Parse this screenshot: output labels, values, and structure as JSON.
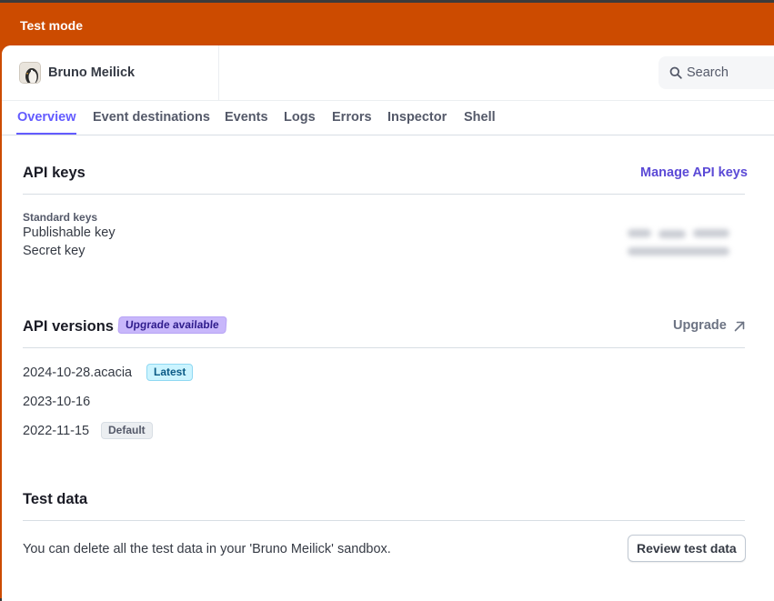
{
  "banner": {
    "label": "Test mode"
  },
  "account": {
    "name": "Bruno Meilick",
    "avatar_icon": "penguin-avatar-icon"
  },
  "search": {
    "label": "Search",
    "icon": "search-icon"
  },
  "tabs": [
    {
      "label": "Overview",
      "active": true
    },
    {
      "label": "Event destinations"
    },
    {
      "label": "Events"
    },
    {
      "label": "Logs"
    },
    {
      "label": "Errors"
    },
    {
      "label": "Inspector"
    },
    {
      "label": "Shell"
    }
  ],
  "api_keys": {
    "title": "API keys",
    "manage_link": "Manage API keys",
    "standard_keys_label": "Standard keys",
    "publishable_label": "Publishable key",
    "secret_label": "Secret key"
  },
  "api_versions": {
    "title": "API versions",
    "upgrade_badge": "Upgrade available",
    "upgrade_link": "Upgrade",
    "upgrade_icon": "external-arrow-icon",
    "versions": [
      {
        "name": "2024-10-28.acacia",
        "badge": "Latest"
      },
      {
        "name": "2023-10-16",
        "badge": ""
      },
      {
        "name": "2022-11-15",
        "badge": "Default"
      }
    ]
  },
  "test_data": {
    "title": "Test data",
    "description": "You can delete all the test data in your 'Bruno Meilick' sandbox.",
    "review_button": "Review test data"
  },
  "colors": {
    "banner": "#cc4b00",
    "accent": "#635bff",
    "link": "#5b4ad6"
  }
}
